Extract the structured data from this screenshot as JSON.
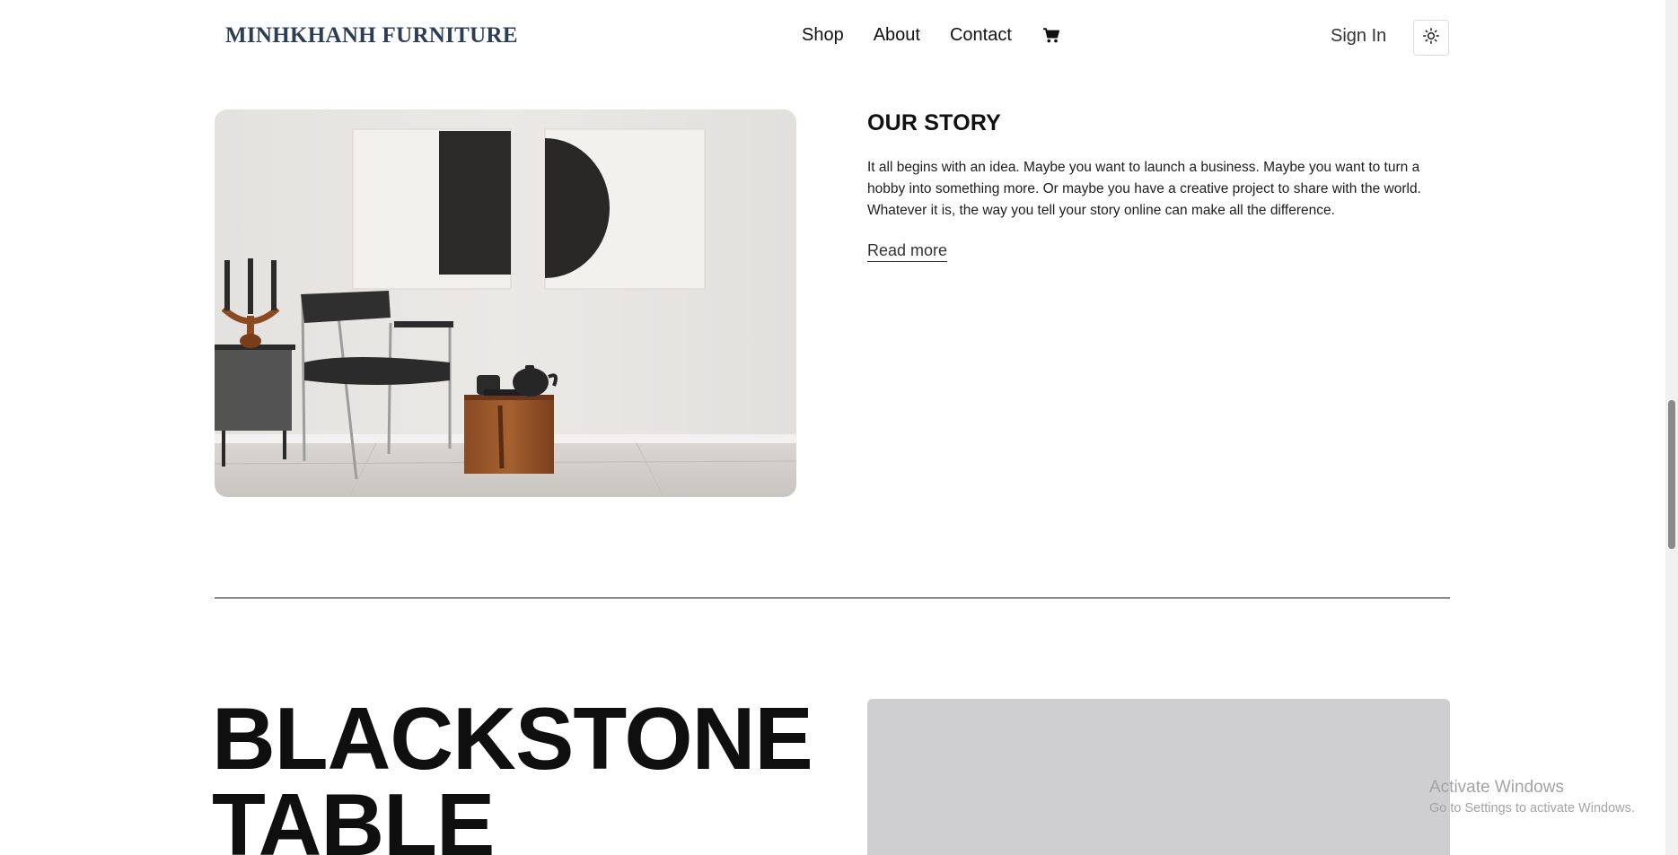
{
  "header": {
    "brand": "MINHKHANH FURNITURE",
    "nav": {
      "shop": "Shop",
      "about": "About",
      "contact": "Contact"
    },
    "cart_icon": "shopping-cart-icon",
    "sign_in": "Sign In",
    "theme_icon": "sun-icon"
  },
  "story": {
    "title": "OUR STORY",
    "body": "It all begins with an idea. Maybe you want to launch a business. Maybe you want to turn a hobby into something more. Or maybe you have a creative project to share with the world. Whatever it is, the way you tell your story online can make all the difference.",
    "read_more": "Read more"
  },
  "product": {
    "title": "BLACKSTONE TABLE"
  },
  "watermark": {
    "line1": "Activate Windows",
    "line2": "Go to Settings to activate Windows."
  },
  "colors": {
    "brand": "#2c3e55",
    "text": "#111111",
    "product_image_bg": "#cfcfd1"
  }
}
